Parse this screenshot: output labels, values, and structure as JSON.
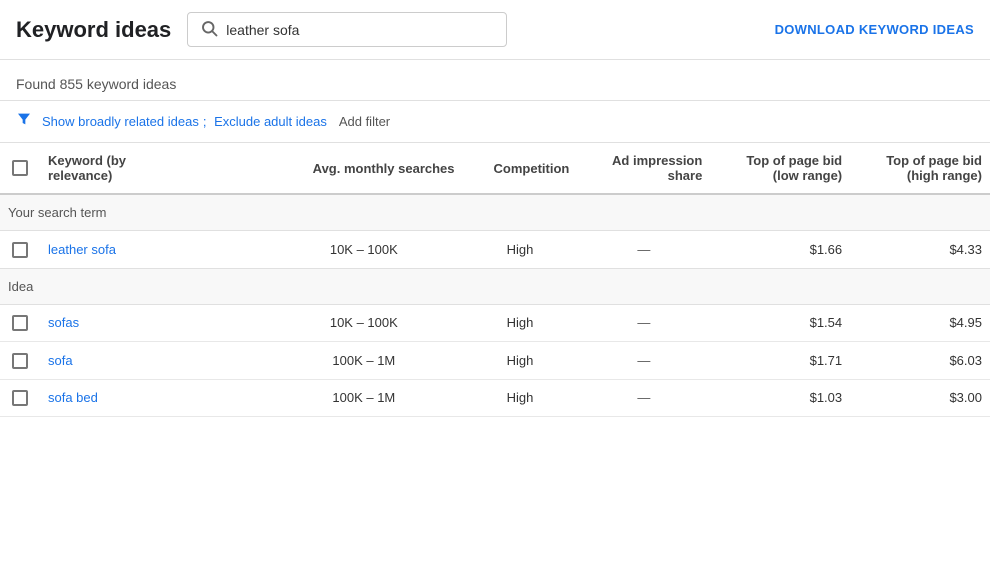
{
  "header": {
    "title": "Keyword ideas",
    "search_value": "leather sofa",
    "download_label": "DOWNLOAD KEYWORD IDEAS"
  },
  "found_text": "Found 855 keyword ideas",
  "filters": {
    "link1": "Show broadly related ideas",
    "separator": ";",
    "link2": "Exclude adult ideas",
    "add_filter": "Add filter"
  },
  "table": {
    "columns": [
      {
        "id": "checkbox",
        "label": ""
      },
      {
        "id": "keyword",
        "label": "Keyword (by relevance)"
      },
      {
        "id": "avg_monthly",
        "label": "Avg. monthly searches"
      },
      {
        "id": "competition",
        "label": "Competition"
      },
      {
        "id": "ad_impression",
        "label": "Ad impression share"
      },
      {
        "id": "top_bid_low",
        "label": "Top of page bid (low range)"
      },
      {
        "id": "top_bid_high",
        "label": "Top of page bid (high range)"
      }
    ],
    "sections": [
      {
        "section_label": "Your search term",
        "rows": [
          {
            "keyword": "leather sofa",
            "avg_monthly": "10K – 100K",
            "competition": "High",
            "ad_impression": "—",
            "top_bid_low": "$1.66",
            "top_bid_high": "$4.33"
          }
        ]
      },
      {
        "section_label": "Idea",
        "rows": [
          {
            "keyword": "sofas",
            "avg_monthly": "10K – 100K",
            "competition": "High",
            "ad_impression": "—",
            "top_bid_low": "$1.54",
            "top_bid_high": "$4.95"
          },
          {
            "keyword": "sofa",
            "avg_monthly": "100K – 1M",
            "competition": "High",
            "ad_impression": "—",
            "top_bid_low": "$1.71",
            "top_bid_high": "$6.03"
          },
          {
            "keyword": "sofa bed",
            "avg_monthly": "100K – 1M",
            "competition": "High",
            "ad_impression": "—",
            "top_bid_low": "$1.03",
            "top_bid_high": "$3.00"
          }
        ]
      }
    ]
  }
}
